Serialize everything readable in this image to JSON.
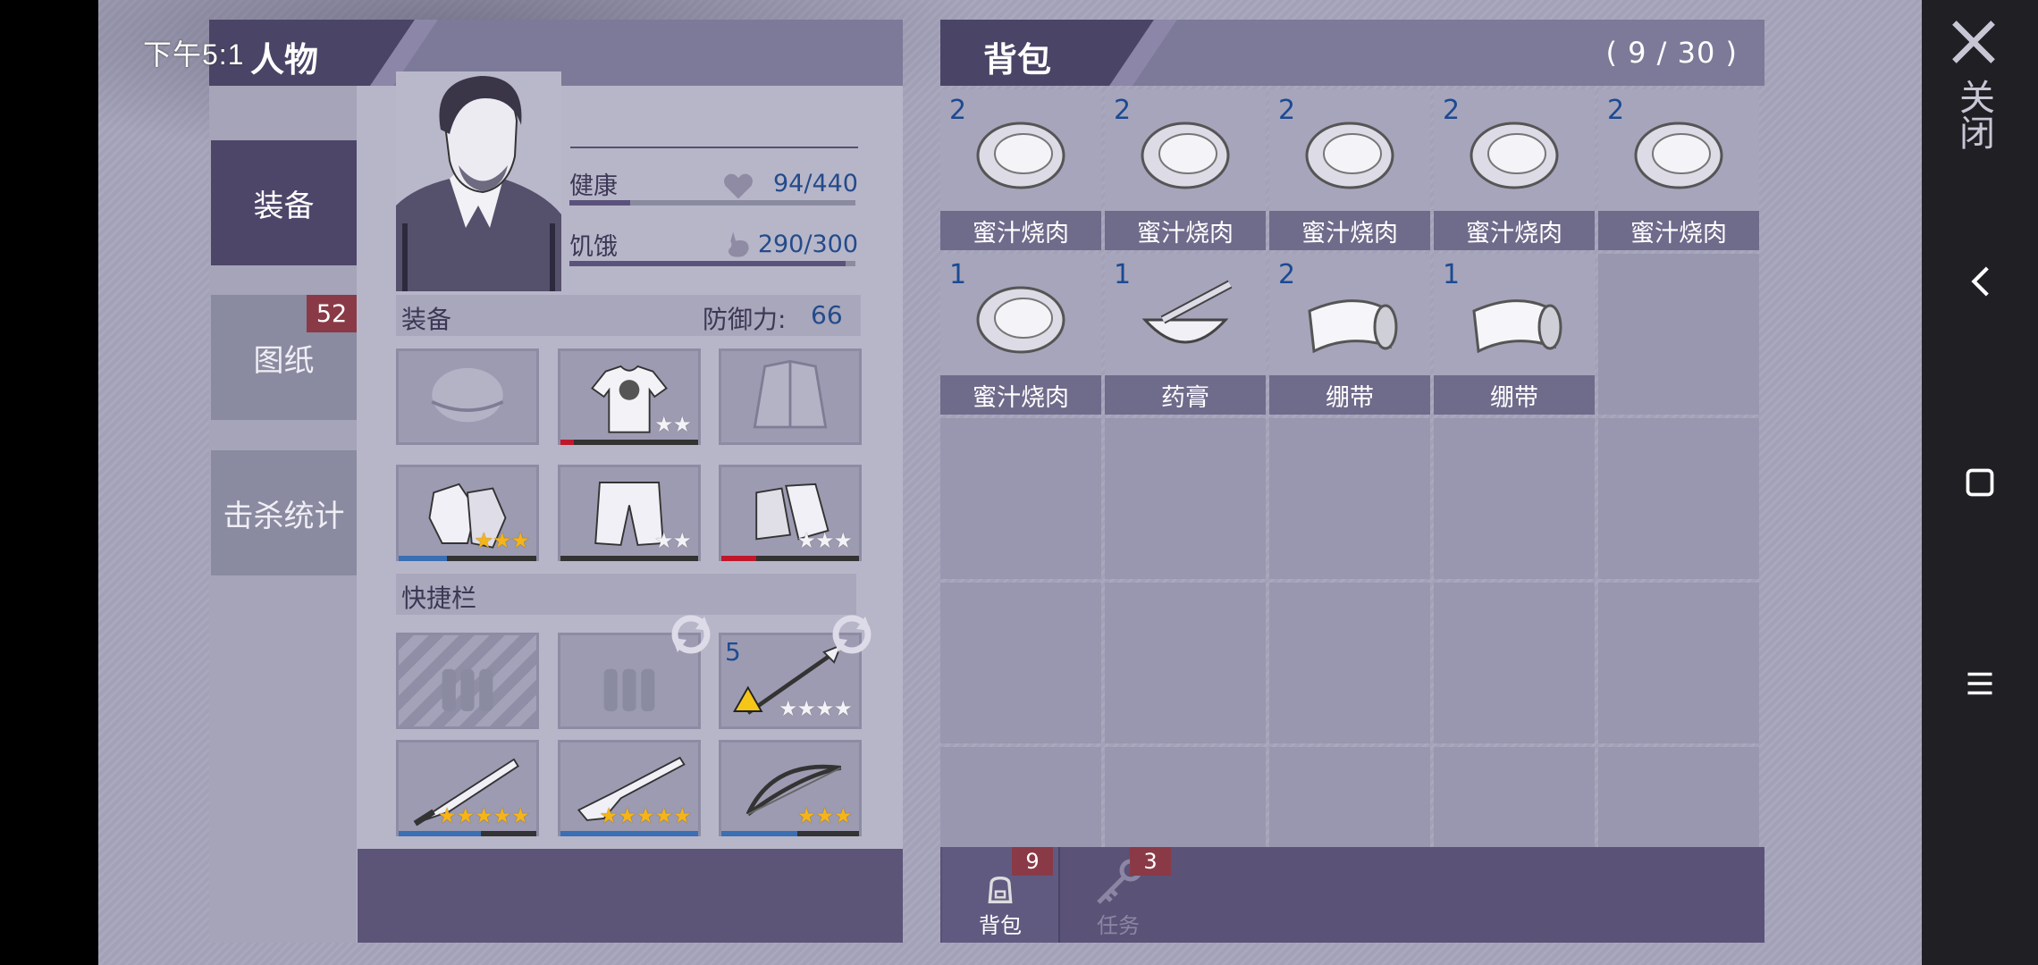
{
  "status": {
    "time": "下午5:1"
  },
  "character_panel": {
    "title": "人物",
    "tabs": [
      {
        "label": "装备",
        "active": true
      },
      {
        "label": "图纸",
        "badge": "52"
      },
      {
        "label": "击杀统计"
      }
    ],
    "stats": {
      "health": {
        "label": "健康",
        "value": "94/440",
        "fraction": 0.214
      },
      "hunger": {
        "label": "饥饿",
        "value": "290/300",
        "fraction": 0.967
      }
    },
    "equipment": {
      "label": "装备",
      "defense_label": "防御力:",
      "defense_value": "66",
      "slots": [
        {
          "name": "hat",
          "stars": 0,
          "max_stars": 0,
          "durability": null,
          "dur_color": null
        },
        {
          "name": "shirt",
          "stars": 0,
          "max_stars": 2,
          "durability": 0.1,
          "dur_color": "#c0182a"
        },
        {
          "name": "jacket",
          "stars": 0,
          "max_stars": 0,
          "durability": null,
          "dur_color": null
        },
        {
          "name": "gloves",
          "stars": 3,
          "max_stars": 3,
          "durability": 0.35,
          "dur_color": "#3a6fb3"
        },
        {
          "name": "pants",
          "stars": 0,
          "max_stars": 2,
          "durability": 0,
          "dur_color": "#3a6fb3"
        },
        {
          "name": "boots",
          "stars": 0,
          "max_stars": 3,
          "durability": 0.25,
          "dur_color": "#c0182a"
        }
      ]
    },
    "quickbar": {
      "label": "快捷栏",
      "slots": [
        {
          "name": "ammo-locked",
          "count": "",
          "stars": 0,
          "max_stars": 0
        },
        {
          "name": "ammo",
          "count": "",
          "stars": 0,
          "max_stars": 0
        },
        {
          "name": "spear",
          "count": "5",
          "stars": 0,
          "max_stars": 4
        },
        {
          "name": "machete",
          "count": "",
          "stars": 5,
          "max_stars": 5,
          "durability": 0.6
        },
        {
          "name": "shotgun",
          "count": "",
          "stars": 5,
          "max_stars": 5,
          "durability": 1.0
        },
        {
          "name": "bow",
          "count": "",
          "stars": 3,
          "max_stars": 3,
          "durability": 0.55
        }
      ]
    }
  },
  "bag": {
    "title": "背包",
    "capacity": "( 9 / 30 )",
    "items": [
      {
        "name": "蜜汁烧肉",
        "count": "2",
        "icon": "meat-icon"
      },
      {
        "name": "蜜汁烧肉",
        "count": "2",
        "icon": "meat-icon"
      },
      {
        "name": "蜜汁烧肉",
        "count": "2",
        "icon": "meat-icon"
      },
      {
        "name": "蜜汁烧肉",
        "count": "2",
        "icon": "meat-icon"
      },
      {
        "name": "蜜汁烧肉",
        "count": "2",
        "icon": "meat-icon"
      },
      {
        "name": "蜜汁烧肉",
        "count": "1",
        "icon": "meat-icon"
      },
      {
        "name": "药膏",
        "count": "1",
        "icon": "ointment-icon"
      },
      {
        "name": "绷带",
        "count": "2",
        "icon": "bandage-icon"
      },
      {
        "name": "绷带",
        "count": "1",
        "icon": "bandage-icon"
      }
    ],
    "tabs": [
      {
        "label": "背包",
        "badge": "9",
        "icon": "backpack-icon"
      },
      {
        "label": "任务",
        "badge": "3",
        "icon": "key-icon"
      }
    ]
  },
  "close": {
    "label": "关闭"
  },
  "navbar": {
    "icons": [
      "back-icon",
      "home-icon",
      "menu-icon"
    ]
  }
}
